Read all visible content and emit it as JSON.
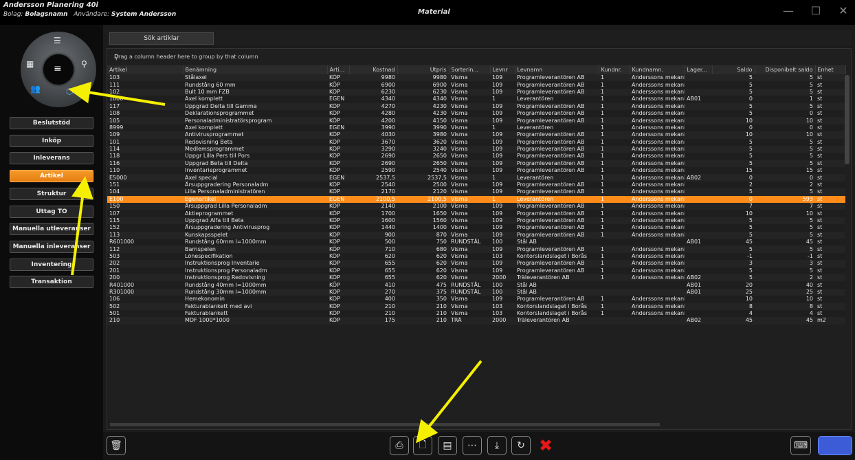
{
  "titlebar": {
    "app_title": "Andersson Planering 40i",
    "bolag_label": "Bolag:",
    "bolag_value": "Bolagsnamn",
    "user_label": "Användare:",
    "user_value": "System Andersson",
    "window_title": "Material"
  },
  "sidebar": {
    "nav": [
      {
        "label": "Beslutstöd"
      },
      {
        "label": "Inköp"
      },
      {
        "label": "Inleverans"
      },
      {
        "label": "Artikel",
        "active": true
      },
      {
        "label": "Struktur"
      },
      {
        "label": "Uttag TO"
      },
      {
        "label": "Manuella utleveranser"
      },
      {
        "label": "Manuella inleveranser"
      },
      {
        "label": "Inventering"
      },
      {
        "label": "Transaktion"
      }
    ]
  },
  "toolbar": {
    "search_label": "Sök artiklar"
  },
  "grid": {
    "group_hint": "Drag a column header here to group by that column",
    "columns": [
      "Artikel",
      "Benämning",
      "Arti...",
      "Kostnad",
      "Utpris",
      "Sorterin...",
      "Levnr",
      "Levnamn",
      "Kundnr.",
      "Kundnamn.",
      "Lager...",
      "Saldo",
      "Disponibelt saldo",
      "Enhet"
    ],
    "rows": [
      [
        "103",
        "Stålaxel",
        "KÖP",
        "9980",
        "9980",
        "Visma",
        "109",
        "Programleverantören AB",
        "1",
        "Anderssons mekanis...",
        "",
        "5",
        "5",
        "st"
      ],
      [
        "111",
        "Rundstång 60 mm",
        "KÖP",
        "6900",
        "6900",
        "Visma",
        "109",
        "Programleverantören AB",
        "1",
        "Anderssons mekanis...",
        "",
        "5",
        "5",
        "st"
      ],
      [
        "102",
        "Bult 10 mm FZB",
        "KÖP",
        "6230",
        "6230",
        "Visma",
        "109",
        "Programleverantören AB",
        "1",
        "Anderssons mekanis...",
        "",
        "5",
        "5",
        "st"
      ],
      [
        "1000",
        "Axel komplett",
        "EGEN",
        "4340",
        "4340",
        "Visma",
        "1",
        "Leverantören",
        "1",
        "Anderssons mekanis...",
        "AB01",
        "0",
        "1",
        "st"
      ],
      [
        "117",
        "Uppgrad Delta till Gamma",
        "KÖP",
        "4270",
        "4230",
        "Visma",
        "109",
        "Programleverantören AB",
        "1",
        "Anderssons mekanis...",
        "",
        "5",
        "5",
        "st"
      ],
      [
        "108",
        "Deklarationsprogrammet",
        "KÖP",
        "4280",
        "4230",
        "Visma",
        "109",
        "Programleverantören AB",
        "1",
        "Anderssons mekanis...",
        "",
        "5",
        "0",
        "st"
      ],
      [
        "105",
        "Personaladministratörsprogram",
        "KÖP",
        "4200",
        "4150",
        "Visma",
        "109",
        "Programleverantören AB",
        "1",
        "Anderssons mekanis...",
        "",
        "10",
        "10",
        "st"
      ],
      [
        "8999",
        "Axel komplett",
        "EGEN",
        "3990",
        "3990",
        "Visma",
        "1",
        "Leverantören",
        "1",
        "Anderssons mekanis...",
        "",
        "0",
        "0",
        "st"
      ],
      [
        "109",
        "Antivirusprogrammet",
        "KÖP",
        "4030",
        "3980",
        "Visma",
        "109",
        "Programleverantören AB",
        "1",
        "Anderssons mekanis...",
        "",
        "10",
        "10",
        "st"
      ],
      [
        "101",
        "Redovisning Beta",
        "KÖP",
        "3670",
        "3620",
        "Visma",
        "109",
        "Programleverantören AB",
        "1",
        "Anderssons mekanis...",
        "",
        "5",
        "5",
        "st"
      ],
      [
        "114",
        "Medlemsprogrammet",
        "KÖP",
        "3290",
        "3240",
        "Visma",
        "109",
        "Programleverantören AB",
        "1",
        "Anderssons mekanis...",
        "",
        "5",
        "5",
        "st"
      ],
      [
        "118",
        "Uppgr Lilla Pers till Pors",
        "KÖP",
        "2690",
        "2650",
        "Visma",
        "109",
        "Programleverantören AB",
        "1",
        "Anderssons mekanis...",
        "",
        "5",
        "5",
        "st"
      ],
      [
        "116",
        "Uppgrad Beta till Delta",
        "KÖP",
        "2690",
        "2650",
        "Visma",
        "109",
        "Programleverantören AB",
        "1",
        "Anderssons mekanis...",
        "",
        "5",
        "5",
        "st"
      ],
      [
        "110",
        "Inventarieprogrammet",
        "KÖP",
        "2590",
        "2540",
        "Visma",
        "109",
        "Programleverantören AB",
        "1",
        "Anderssons mekanis...",
        "",
        "15",
        "15",
        "st"
      ],
      [
        "E5000",
        "Axel special",
        "EGEN",
        "2537,5",
        "2537,5",
        "Visma",
        "1",
        "Leverantören",
        "1",
        "Anderssons mekanis...",
        "AB02",
        "0",
        "0",
        "st"
      ],
      [
        "151",
        "Årsuppgradering Personaladm",
        "KÖP",
        "2540",
        "2500",
        "Visma",
        "109",
        "Programleverantören AB",
        "1",
        "Anderssons mekanis...",
        "",
        "2",
        "2",
        "st"
      ],
      [
        "104",
        "Lilla Personaladministratören",
        "KÖP",
        "2170",
        "2120",
        "Visma",
        "109",
        "Programleverantören AB",
        "1",
        "Anderssons mekanis...",
        "",
        "5",
        "5",
        "st"
      ],
      [
        "E100",
        "Egenartikel",
        "EGEN",
        "2100,5",
        "2100,5",
        "Visma",
        "1",
        "Leverantören",
        "1",
        "Anderssons mekanis...",
        "",
        "0",
        "593",
        "st"
      ],
      [
        "150",
        "Årsuppgrad Lilla Personaladm",
        "KÖP",
        "2140",
        "2100",
        "Visma",
        "109",
        "Programleverantören AB",
        "1",
        "Anderssons mekanis...",
        "",
        "7",
        "7",
        "st"
      ],
      [
        "107",
        "Aktieprogrammet",
        "KÖP",
        "1700",
        "1650",
        "Visma",
        "109",
        "Programleverantören AB",
        "1",
        "Anderssons mekanis...",
        "",
        "10",
        "10",
        "st"
      ],
      [
        "115",
        "Uppgrad Alfa till Beta",
        "KÖP",
        "1600",
        "1560",
        "Visma",
        "109",
        "Programleverantören AB",
        "1",
        "Anderssons mekanis...",
        "",
        "5",
        "5",
        "st"
      ],
      [
        "152",
        "Årsuppgradering Antivirusprog",
        "KÖP",
        "1440",
        "1400",
        "Visma",
        "109",
        "Programleverantören AB",
        "1",
        "Anderssons mekanis...",
        "",
        "5",
        "5",
        "st"
      ],
      [
        "113",
        "Kunskapsspelet",
        "KÖP",
        "900",
        "870",
        "Visma",
        "109",
        "Programleverantören AB",
        "1",
        "Anderssons mekanis...",
        "",
        "5",
        "5",
        "st"
      ],
      [
        "R601000",
        "Rundstång 60mm l=1000mm",
        "KÖP",
        "500",
        "750",
        "RUNDSTÅL",
        "100",
        "Stål AB",
        "",
        "",
        "AB01",
        "45",
        "45",
        "st"
      ],
      [
        "112",
        "Barnspelen",
        "KÖP",
        "710",
        "680",
        "Visma",
        "109",
        "Programleverantören AB",
        "1",
        "Anderssons mekanis...",
        "",
        "5",
        "5",
        "st"
      ],
      [
        "503",
        "Lönespecifikation",
        "KÖP",
        "620",
        "620",
        "Visma",
        "103",
        "Kontorslandslaget i Borås",
        "1",
        "Anderssons mekanis...",
        "",
        "-1",
        "-1",
        "st"
      ],
      [
        "202",
        "Instruktionsprog Inventarie",
        "KÖP",
        "655",
        "620",
        "Visma",
        "109",
        "Programleverantören AB",
        "1",
        "Anderssons mekanis...",
        "",
        "3",
        "3",
        "st"
      ],
      [
        "201",
        "Instruktionsprog Personaladm",
        "KÖP",
        "655",
        "620",
        "Visma",
        "109",
        "Programleverantören AB",
        "1",
        "Anderssons mekanis...",
        "",
        "5",
        "5",
        "st"
      ],
      [
        "200",
        "Instruktionsprog Redovisning",
        "KÖP",
        "655",
        "620",
        "Visma",
        "2000",
        "Träleverantören AB",
        "1",
        "Anderssons mekanis...",
        "AB02",
        "5",
        "2",
        "st"
      ],
      [
        "R401000",
        "Rundstång 40mm l=1000mm",
        "KÖP",
        "410",
        "475",
        "RUNDSTÅL",
        "100",
        "Stål AB",
        "",
        "",
        "AB01",
        "20",
        "40",
        "st"
      ],
      [
        "R301000",
        "Rundstång 30mm l=1000mm",
        "KÖP",
        "270",
        "375",
        "RUNDSTÅL",
        "100",
        "Stål AB",
        "",
        "",
        "AB01",
        "25",
        "25",
        "st"
      ],
      [
        "106",
        "Hemekonomin",
        "KÖP",
        "400",
        "350",
        "Visma",
        "109",
        "Programleverantören AB",
        "1",
        "Anderssons mekanis...",
        "",
        "10",
        "10",
        "st"
      ],
      [
        "502",
        "Fakturablankett med avi",
        "KÖP",
        "210",
        "210",
        "Visma",
        "103",
        "Kontorslandslaget i Borås",
        "1",
        "Anderssons mekanis...",
        "",
        "8",
        "8",
        "st"
      ],
      [
        "501",
        "Fakturablankett",
        "KÖP",
        "210",
        "210",
        "Visma",
        "103",
        "Kontorslandslaget i Borås",
        "1",
        "Anderssons mekanis...",
        "",
        "4",
        "4",
        "st"
      ],
      [
        "210",
        "MDF 1000*1000",
        "KÖP",
        "175",
        "210",
        "TRÄ",
        "2000",
        "Träleverantören AB",
        "",
        "",
        "AB02",
        "45",
        "45",
        "m2"
      ]
    ],
    "selected_row": 17
  },
  "bottom_toolbar": {
    "icons": [
      "trash-icon",
      "print-icon",
      "new-document-icon",
      "document-icon",
      "more-icon",
      "export-icon",
      "refresh-icon",
      "close-red-icon",
      "keyboard-icon"
    ]
  },
  "colors": {
    "accent": "#ff8c1a",
    "annotation_arrow": "#f5f000",
    "cancel": "#e41818"
  }
}
